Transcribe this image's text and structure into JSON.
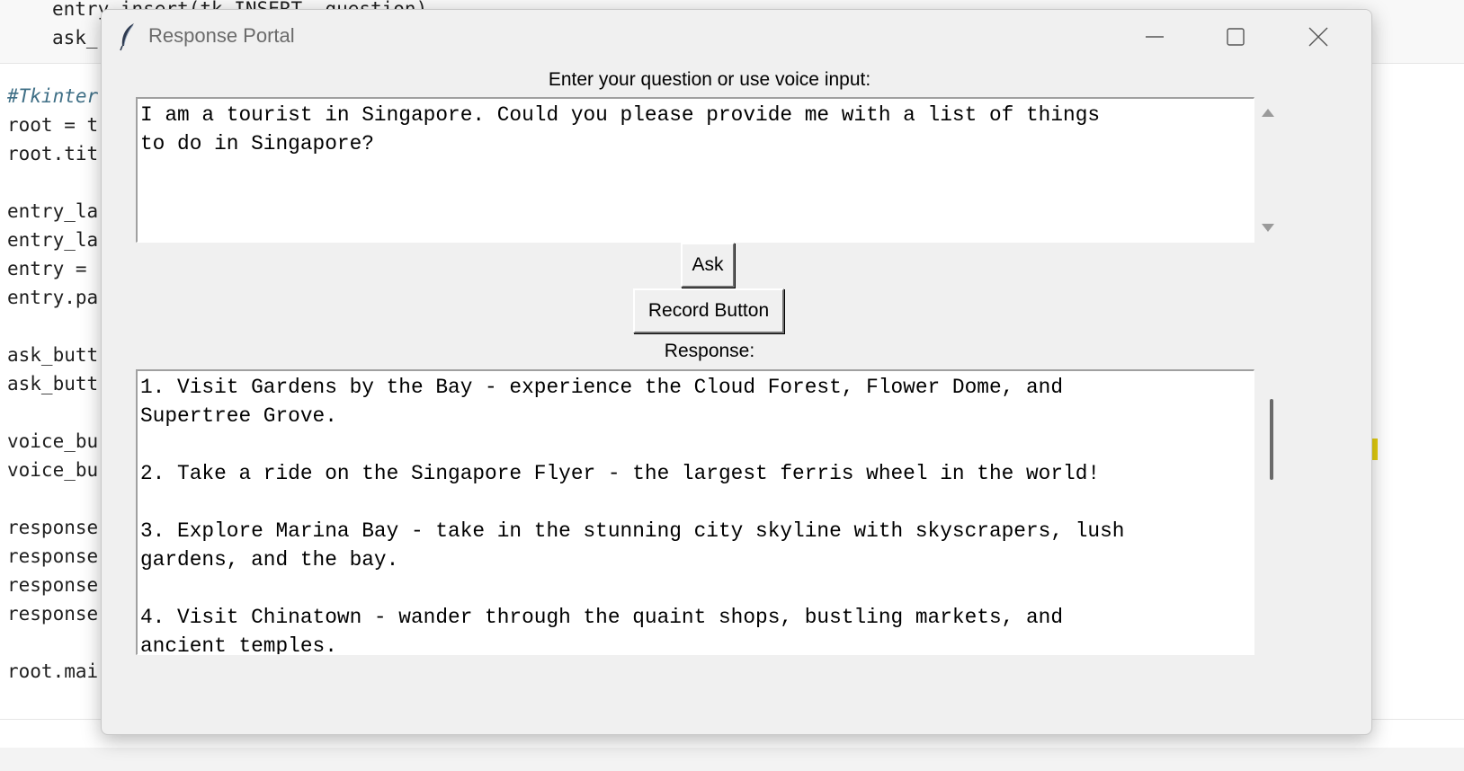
{
  "editor": {
    "lines": [
      {
        "id": "l1",
        "text": "entry.insert(tk.INSERT, question)"
      },
      {
        "id": "l2",
        "text": "ask_"
      },
      {
        "id": "l3",
        "text": "#Tkinter"
      },
      {
        "id": "l4",
        "text": "root = t"
      },
      {
        "id": "l5",
        "text": "root.tit"
      },
      {
        "id": "l6",
        "text": "entry_la"
      },
      {
        "id": "l7",
        "text": "entry_la"
      },
      {
        "id": "l8",
        "text": "entry = "
      },
      {
        "id": "l9",
        "text": "entry.pa"
      },
      {
        "id": "l10",
        "text": "ask_butt"
      },
      {
        "id": "l11",
        "text": "ask_butt"
      },
      {
        "id": "l12",
        "text": "voice_bu"
      },
      {
        "id": "l13",
        "text": "voice_bu"
      },
      {
        "id": "l14",
        "text": "response"
      },
      {
        "id": "l15",
        "text": "response"
      },
      {
        "id": "l16",
        "text": "response"
      },
      {
        "id": "l17",
        "text": "response"
      },
      {
        "id": "l18",
        "text": "root.mai"
      }
    ]
  },
  "window": {
    "title": "Response Portal",
    "question_label": "Enter your question or use voice input:",
    "question_text": "I am a tourist in Singapore. Could you please provide me with a list of things\nto do in Singapore?",
    "ask_label": "Ask",
    "record_label": "Record Button",
    "response_label": "Response:",
    "response_text": "1. Visit Gardens by the Bay - experience the Cloud Forest, Flower Dome, and\nSupertree Grove.\n\n2. Take a ride on the Singapore Flyer - the largest ferris wheel in the world!\n\n3. Explore Marina Bay - take in the stunning city skyline with skyscrapers, lush\ngardens, and the bay.\n\n4. Visit Chinatown - wander through the quaint shops, bustling markets, and\nancient temples."
  },
  "icons": {
    "title_icon": "feather-icon",
    "minimize": "minimize-icon",
    "maximize": "maximize-icon",
    "close": "close-icon",
    "scroll_up": "arrow-up-icon",
    "scroll_down": "arrow-down-icon"
  }
}
